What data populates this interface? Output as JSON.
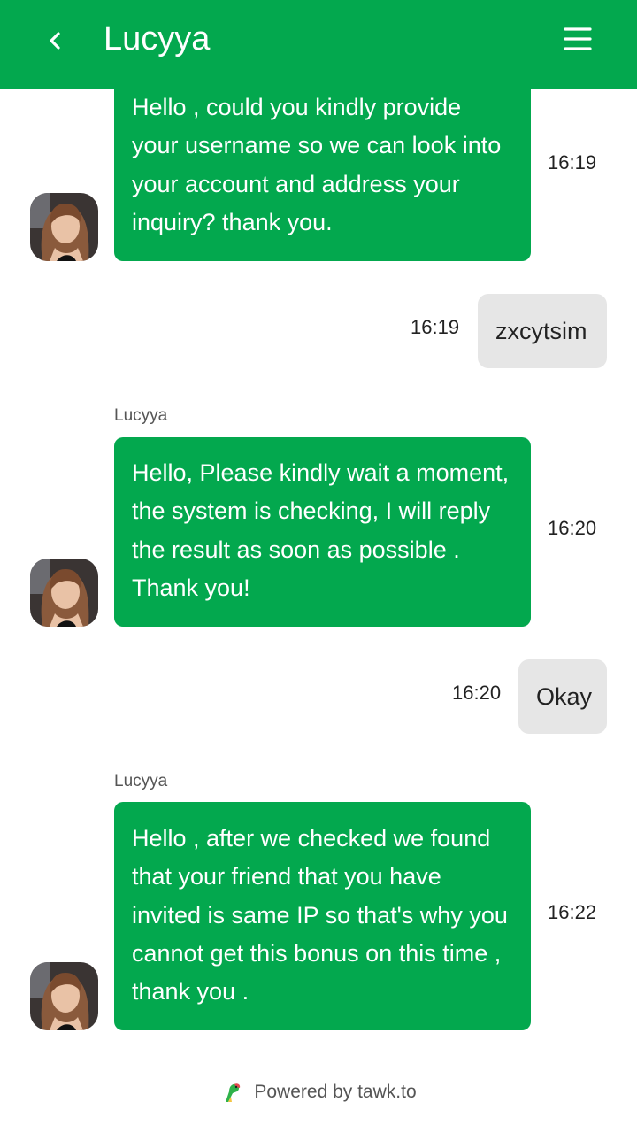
{
  "header": {
    "title": "Lucyya",
    "bg_color": "#03a84e",
    "back_icon": "chevron-left-icon",
    "menu_icon": "hamburger-menu-icon"
  },
  "messages": [
    {
      "from": "agent",
      "sender": "",
      "text": "Hello , could you kindly provide your username so we can look into your account and address your inquiry? thank you.",
      "time": "16:19"
    },
    {
      "from": "user",
      "text": "zxcytsim",
      "time": "16:19"
    },
    {
      "from": "agent",
      "sender": "Lucyya",
      "text": "Hello, Please kindly wait a moment, the system is checking, I will reply the result as soon as possible . Thank you!",
      "time": "16:20"
    },
    {
      "from": "user",
      "text": "Okay",
      "time": "16:20"
    },
    {
      "from": "agent",
      "sender": "Lucyya",
      "text": "Hello , after we checked we found that your friend that you have invited is same IP so that's why you cannot get this bonus on this time , thank you .",
      "time": "16:22"
    }
  ],
  "footer": {
    "text": "Powered by tawk.to",
    "logo_icon": "tawk-parrot-icon"
  },
  "colors": {
    "agent_bubble": "#03a84e",
    "user_bubble": "#e6e6e6"
  }
}
